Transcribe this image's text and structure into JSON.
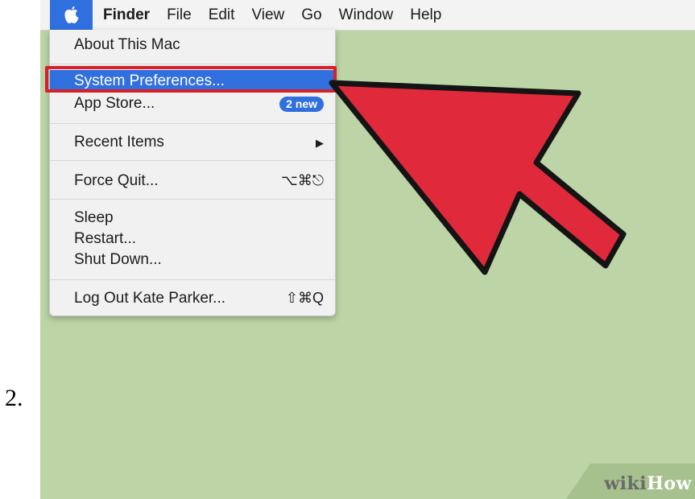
{
  "step": {
    "number": "2."
  },
  "menubar": {
    "apple_icon": "apple-logo",
    "titles": [
      "Finder",
      "File",
      "Edit",
      "View",
      "Go",
      "Window",
      "Help"
    ]
  },
  "apple_menu": {
    "about": "About This Mac",
    "system_preferences": "System Preferences...",
    "app_store": "App Store...",
    "app_store_badge": "2 new",
    "recent_items": "Recent Items",
    "recent_items_arrow": "▶",
    "force_quit": "Force Quit...",
    "force_quit_shortcut": "⌥⌘⎋",
    "sleep": "Sleep",
    "restart": "Restart...",
    "shut_down": "Shut Down...",
    "log_out": "Log Out Kate Parker...",
    "log_out_shortcut": "⇧⌘Q"
  },
  "annotation": {
    "arrow_color": "#e02a3b",
    "highlight_color": "#d8202a"
  },
  "watermark": {
    "wiki": "wiki",
    "how": "How"
  },
  "colors": {
    "desktop": "#bcd4a6",
    "selection": "#2f6fde"
  }
}
